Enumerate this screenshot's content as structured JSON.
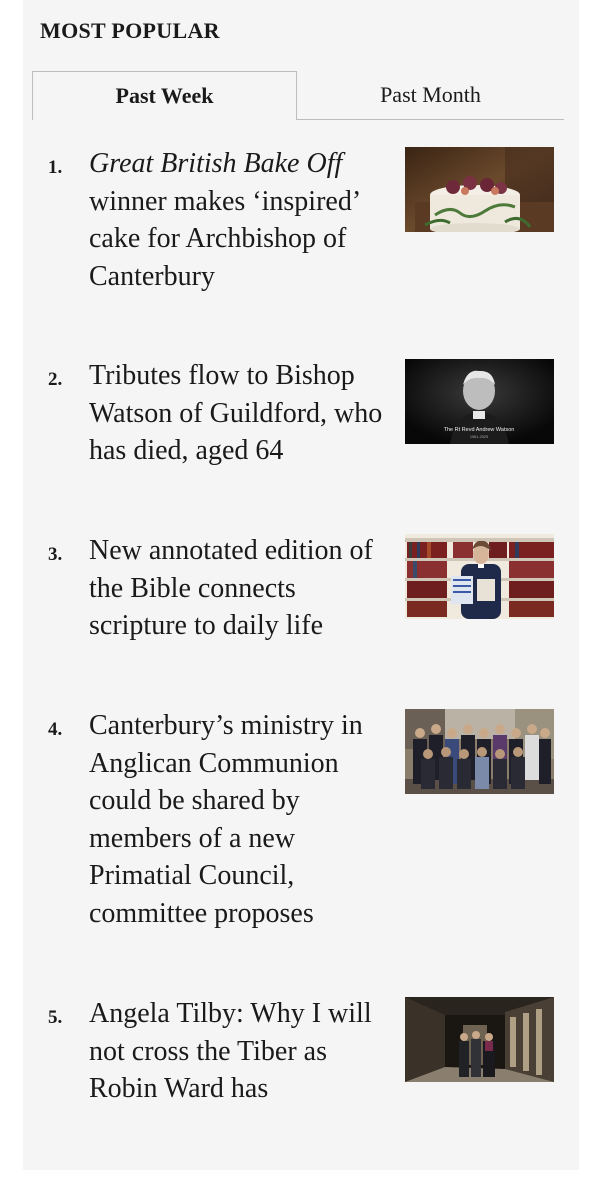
{
  "section": {
    "heading": "MOST POPULAR"
  },
  "tabs": [
    {
      "label": "Past Week",
      "active": true
    },
    {
      "label": "Past Month",
      "active": false
    }
  ],
  "articles": [
    {
      "rank": "1.",
      "title_italic": "Great British Bake Off",
      "title": " winner makes ‘inspired’ cake for Archbishop of Canterbury",
      "image": "cake-photo"
    },
    {
      "rank": "2.",
      "title": "Tributes flow to Bishop Watson of Guildford, who has died, aged 64",
      "image": "bishop-portrait",
      "image_caption": "The Rt Revd Andrew Watson",
      "image_subcaption": "1961-2025"
    },
    {
      "rank": "3.",
      "title": "New annotated edition of the Bible connects scripture to daily life",
      "image": "bible-library-photo"
    },
    {
      "rank": "4.",
      "title": "Canterbury’s ministry in Anglican Communion could be shared by members of a new Primatial Council, committee proposes",
      "image": "group-photo"
    },
    {
      "rank": "5.",
      "title": "Angela Tilby: Why I will not cross the Tiber as Robin Ward has",
      "image": "corridor-photo"
    }
  ]
}
